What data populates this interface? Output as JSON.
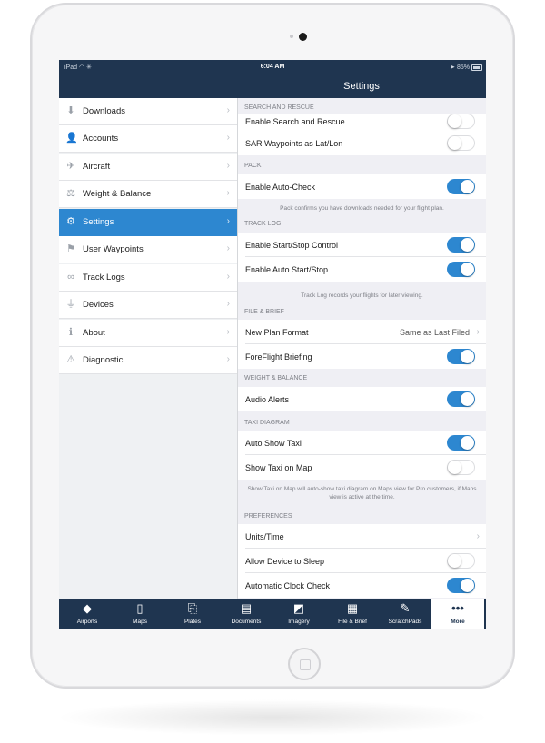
{
  "status": {
    "carrier": "iPad",
    "time": "6:04 AM",
    "battery": "85%"
  },
  "nav": {
    "title": "Settings"
  },
  "sidebar": {
    "items": [
      {
        "label": "Downloads",
        "icon": "download-icon",
        "glyph": "⬇"
      },
      {
        "label": "Accounts",
        "icon": "person-icon",
        "glyph": "👤"
      },
      {
        "label": "Aircraft",
        "icon": "airplane-icon",
        "glyph": "✈"
      },
      {
        "label": "Weight & Balance",
        "icon": "scale-icon",
        "glyph": "⚖"
      },
      {
        "label": "Settings",
        "icon": "gear-icon",
        "glyph": "⚙",
        "active": true
      },
      {
        "label": "User Waypoints",
        "icon": "flag-icon",
        "glyph": "⚑"
      },
      {
        "label": "Track Logs",
        "icon": "track-icon",
        "glyph": "∞"
      },
      {
        "label": "Devices",
        "icon": "plug-icon",
        "glyph": "⏚"
      },
      {
        "label": "About",
        "icon": "info-icon",
        "glyph": "ℹ"
      },
      {
        "label": "Diagnostic",
        "icon": "diagnostic-icon",
        "glyph": "⚠"
      }
    ]
  },
  "settings": {
    "sar": {
      "header": "SEARCH AND RESCUE",
      "enable": "Enable Search and Rescue",
      "latlon": "SAR Waypoints as Lat/Lon"
    },
    "pack": {
      "header": "PACK",
      "auto_check": "Enable Auto-Check",
      "note": "Pack confirms you have downloads needed for your flight plan."
    },
    "track_log": {
      "header": "TRACK LOG",
      "start_stop": "Enable Start/Stop Control",
      "auto_start_stop": "Enable Auto Start/Stop",
      "note": "Track Log records your flights for later viewing."
    },
    "file_brief": {
      "header": "FILE & BRIEF",
      "new_plan_format": "New Plan Format",
      "new_plan_value": "Same as Last Filed",
      "briefing": "ForeFlight Briefing"
    },
    "weight_balance": {
      "header": "WEIGHT & BALANCE",
      "audio_alerts": "Audio Alerts"
    },
    "taxi": {
      "header": "TAXI DIAGRAM",
      "auto_show": "Auto Show Taxi",
      "show_on_map": "Show Taxi on Map",
      "note": "Show Taxi on Map will auto-show taxi diagram on Maps view for Pro customers, if Maps view is active at the time."
    },
    "preferences": {
      "header": "PREFERENCES",
      "units": "Units/Time",
      "sleep": "Allow Device to Sleep",
      "clock": "Automatic Clock Check"
    }
  },
  "tabs": [
    {
      "label": "Airports",
      "icon": "airport-icon",
      "glyph": "◆"
    },
    {
      "label": "Maps",
      "icon": "map-icon",
      "glyph": "▯"
    },
    {
      "label": "Plates",
      "icon": "plates-icon",
      "glyph": "⎘"
    },
    {
      "label": "Documents",
      "icon": "documents-icon",
      "glyph": "▤"
    },
    {
      "label": "Imagery",
      "icon": "imagery-icon",
      "glyph": "◩"
    },
    {
      "label": "File & Brief",
      "icon": "file-brief-icon",
      "glyph": "▦"
    },
    {
      "label": "ScratchPads",
      "icon": "pen-icon",
      "glyph": "✎"
    },
    {
      "label": "More",
      "icon": "more-icon",
      "glyph": "•••",
      "active": true
    }
  ],
  "colors": {
    "nav_bg": "#1f3550",
    "accent": "#2d87d0"
  }
}
